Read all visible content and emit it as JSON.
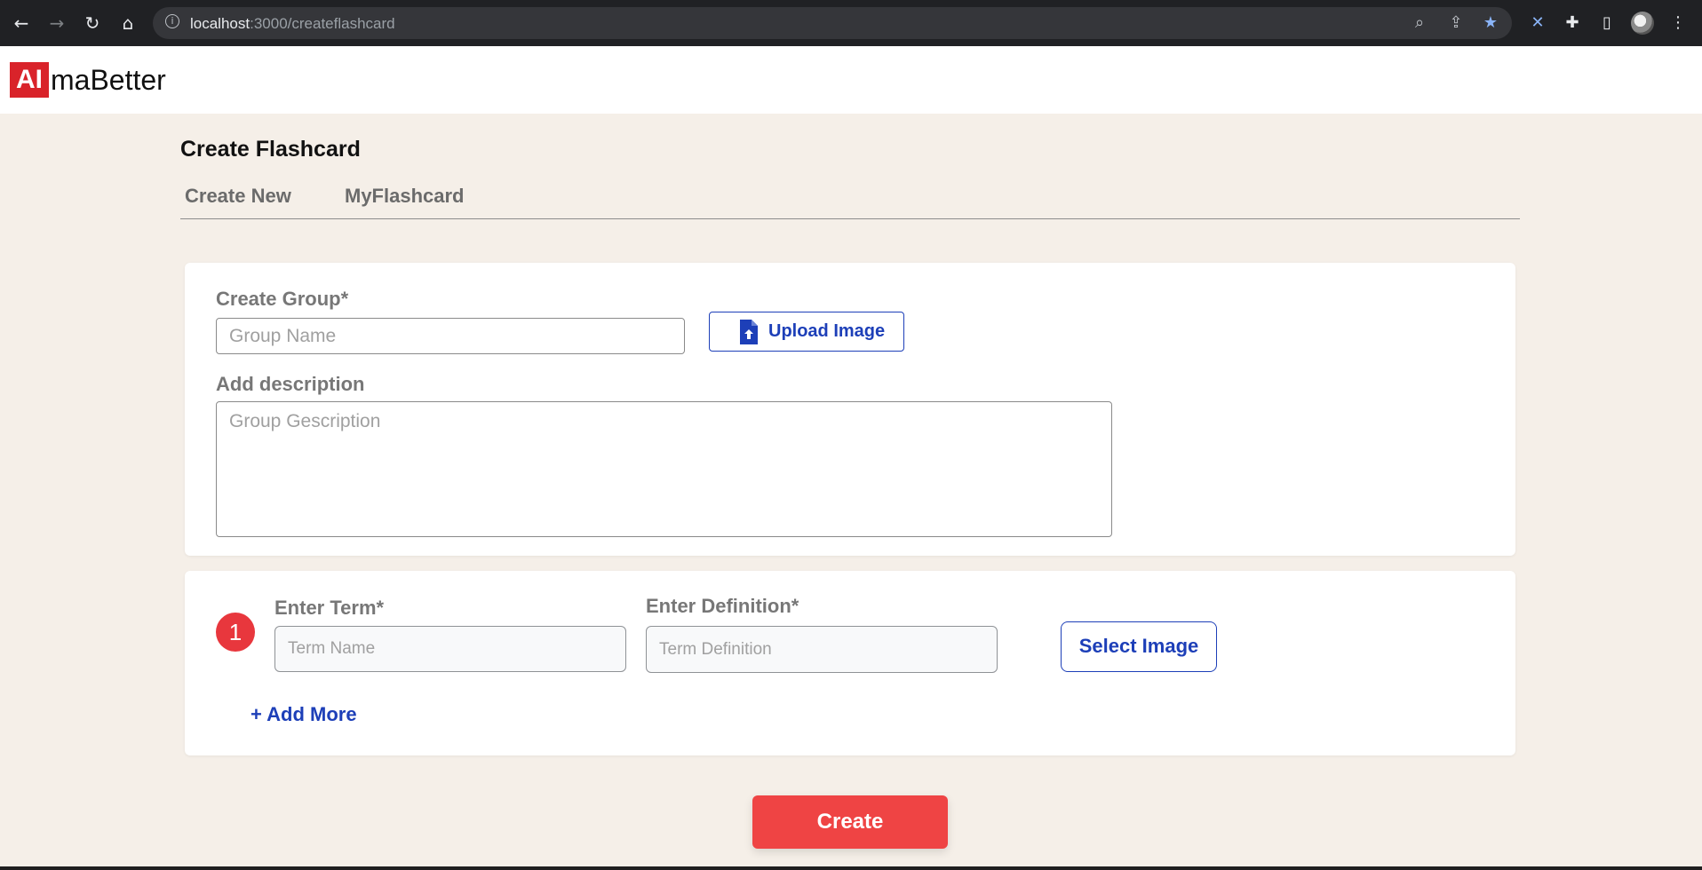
{
  "browser": {
    "url_host": "localhost",
    "url_path": ":3000/createflashcard",
    "icons": [
      "back-arrow-icon",
      "forward-arrow-icon",
      "reload-icon",
      "home-icon",
      "info-icon",
      "zoom-icon",
      "share-icon",
      "bookmark-star-icon",
      "extension-icon",
      "puzzle-icon",
      "side-panel-icon",
      "profile-avatar",
      "menu-kebab-icon"
    ]
  },
  "brand": {
    "logo_mark": "AI",
    "logo_text": "maBetter",
    "color": "#d9232a"
  },
  "page": {
    "title": "Create Flashcard",
    "tabs": [
      {
        "label": "Create New"
      },
      {
        "label": "MyFlashcard"
      }
    ]
  },
  "group_form": {
    "group_label": "Create Group*",
    "group_placeholder": "Group Name",
    "upload_label": "Upload Image",
    "description_label": "Add description",
    "description_placeholder": "Group Gescription"
  },
  "term_form": {
    "index": "1",
    "term_label": "Enter Term*",
    "term_placeholder": "Term Name",
    "definition_label": "Enter Definition*",
    "definition_placeholder": "Term Definition",
    "select_image_label": "Select Image",
    "add_more_label": "+ Add More"
  },
  "actions": {
    "create_label": "Create"
  },
  "colors": {
    "accent_blue": "#1d3fb8",
    "action_red": "#ef4444",
    "page_bg": "#f5efe8"
  }
}
